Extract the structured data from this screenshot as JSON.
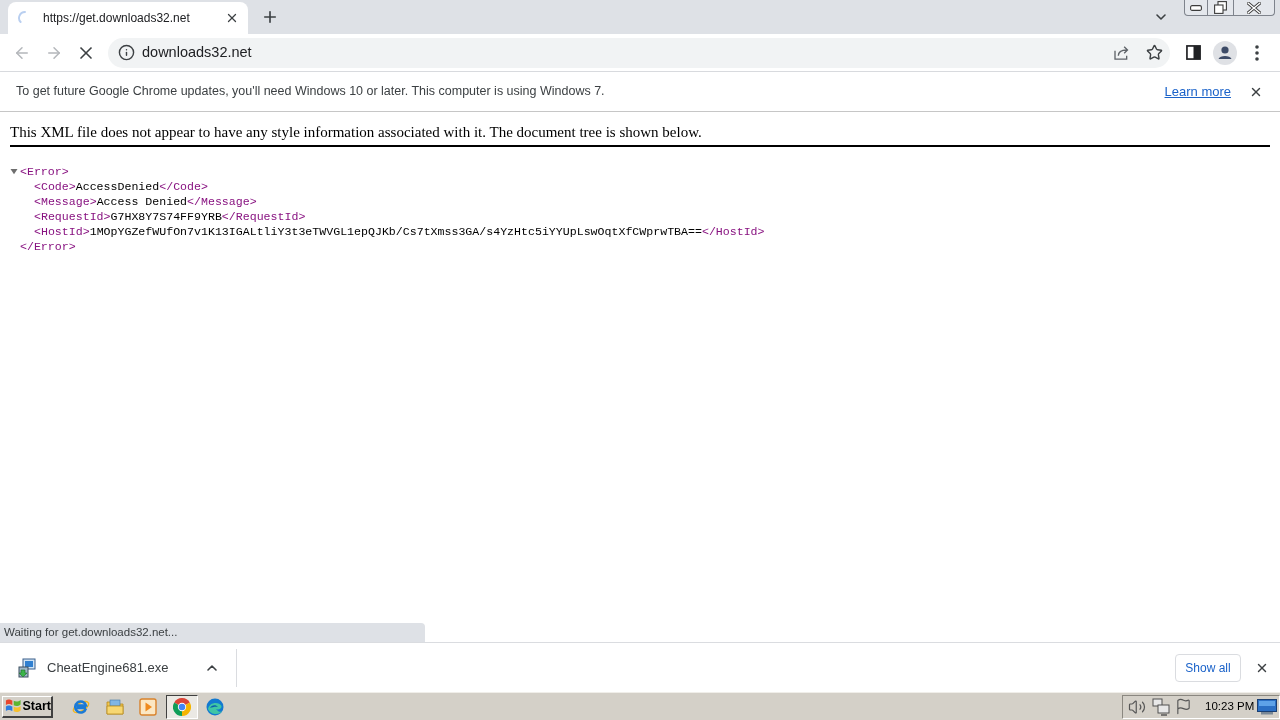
{
  "browser": {
    "tabs": [
      {
        "title": "https://get.downloads32.net",
        "selected": true,
        "loading": true
      }
    ],
    "back": {
      "disabled": true
    },
    "forward": {
      "disabled": true
    },
    "address": "downloads32.net"
  },
  "infobar": {
    "message": "To get future Google Chrome updates, you'll need Windows 10 or later. This computer is using Windows 7.",
    "link": "Learn more"
  },
  "xml_viewer": {
    "notice": "This XML file does not appear to have any style information associated with it. The document tree is shown below.",
    "tree": {
      "open": "<Error>",
      "close": "</Error>",
      "expanded": true,
      "children": [
        {
          "open": "<Code>",
          "text": "AccessDenied",
          "close": "</Code>"
        },
        {
          "open": "<Message>",
          "text": "Access Denied",
          "close": "</Message>"
        },
        {
          "open": "<RequestId>",
          "text": "G7HX8Y7S74FF9YRB",
          "close": "</RequestId>"
        },
        {
          "open": "<HostId>",
          "text": "1MOpYGZefWUfOn7v1K13IGALtliY3t3eTWVGL1epQJKb/Cs7tXmss3GA/s4YzHtc5iYYUpLswOqtXfCWprwTBA==",
          "close": "</HostId>"
        }
      ]
    }
  },
  "status_bubble": "Waiting for get.downloads32.net...",
  "download_shelf": {
    "items": [
      {
        "filename": "CheatEngine681.exe"
      }
    ],
    "show_all": "Show all"
  },
  "taskbar": {
    "start": "Start",
    "apps": [
      {
        "kind": "ie",
        "active": false
      },
      {
        "kind": "explorer",
        "active": false
      },
      {
        "kind": "media",
        "active": false
      },
      {
        "kind": "chrome",
        "active": true
      },
      {
        "kind": "edge",
        "active": false
      }
    ],
    "clock": "10:23 PM"
  }
}
